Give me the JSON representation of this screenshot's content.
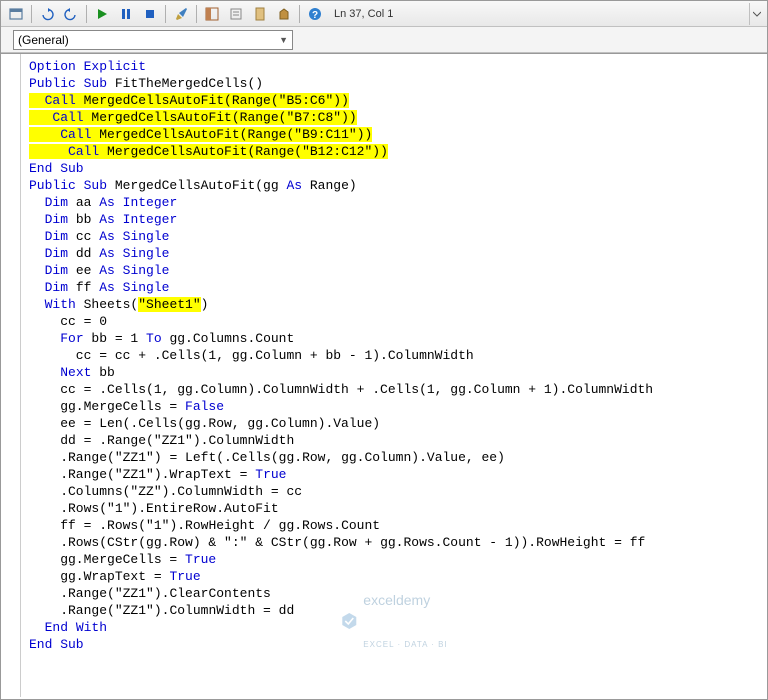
{
  "toolbar": {
    "status": "Ln 37, Col 1"
  },
  "dropdown": {
    "selected": "(General)"
  },
  "code": {
    "l1_opt": "Option Explicit",
    "l2_a": "Public Sub",
    "l2_b": " FitTheMergedCells()",
    "l3_a": "  ",
    "l3_call": "Call",
    "l3_b": " MergedCellsAutoFit(Range(",
    "l3_str": "\"B5:C6\"",
    "l3_c": "))",
    "l4_a": "   ",
    "l4_call": "Call",
    "l4_b": " MergedCellsAutoFit(Range(",
    "l4_str": "\"B7:C8\"",
    "l4_c": "))",
    "l5_a": "    ",
    "l5_call": "Call",
    "l5_b": " MergedCellsAutoFit(Range(",
    "l5_str": "\"B9:C11\"",
    "l5_c": "))",
    "l6_a": "     ",
    "l6_call": "Call",
    "l6_b": " MergedCellsAutoFit(Range(",
    "l6_str": "\"B12:C12\"",
    "l6_c": "))",
    "l7": "End Sub",
    "l8_a": "Public Sub",
    "l8_b": " MergedCellsAutoFit(gg ",
    "l8_as": "As",
    "l8_c": " Range)",
    "l9_a": "  ",
    "l9_dim": "Dim",
    "l9_b": " aa ",
    "l9_as": "As Integer",
    "l10_a": "  ",
    "l10_dim": "Dim",
    "l10_b": " bb ",
    "l10_as": "As Integer",
    "l11_a": "  ",
    "l11_dim": "Dim",
    "l11_b": " cc ",
    "l11_as": "As Single",
    "l12_a": "  ",
    "l12_dim": "Dim",
    "l12_b": " dd ",
    "l12_as": "As Single",
    "l13_a": "  ",
    "l13_dim": "Dim",
    "l13_b": " ee ",
    "l13_as": "As Single",
    "l14_a": "  ",
    "l14_dim": "Dim",
    "l14_b": " ff ",
    "l14_as": "As Single",
    "l15_a": "  ",
    "l15_with": "With",
    "l15_b": " Sheets(",
    "l15_str": "\"Sheet1\"",
    "l15_c": ")",
    "l16": "    cc = 0",
    "l17_a": "    ",
    "l17_for": "For",
    "l17_b": " bb = 1 ",
    "l17_to": "To",
    "l17_c": " gg.Columns.Count",
    "l18": "      cc = cc + .Cells(1, gg.Column + bb - 1).ColumnWidth",
    "l19_a": "    ",
    "l19_next": "Next",
    "l19_b": " bb",
    "l20": "    cc = .Cells(1, gg.Column).ColumnWidth + .Cells(1, gg.Column + 1).ColumnWidth",
    "l21_a": "    gg.MergeCells = ",
    "l21_false": "False",
    "l22": "    ee = Len(.Cells(gg.Row, gg.Column).Value)",
    "l23_a": "    dd = .Range(",
    "l23_str": "\"ZZ1\"",
    "l23_b": ").ColumnWidth",
    "l24_a": "    .Range(",
    "l24_str": "\"ZZ1\"",
    "l24_b": ") = Left(.Cells(gg.Row, gg.Column).Value, ee)",
    "l25_a": "    .Range(",
    "l25_str": "\"ZZ1\"",
    "l25_b": ").WrapText = ",
    "l25_true": "True",
    "l26_a": "    .Columns(",
    "l26_str": "\"ZZ\"",
    "l26_b": ").ColumnWidth = cc",
    "l27_a": "    .Rows(",
    "l27_str": "\"1\"",
    "l27_b": ").EntireRow.AutoFit",
    "l28_a": "    ff = .Rows(",
    "l28_str": "\"1\"",
    "l28_b": ").RowHeight / gg.Rows.Count",
    "l29_a": "    .Rows(CStr(gg.Row) & ",
    "l29_str": "\":\"",
    "l29_b": " & CStr(gg.Row + gg.Rows.Count - 1)).RowHeight = ff",
    "l30_a": "    gg.MergeCells = ",
    "l30_true": "True",
    "l31_a": "    gg.WrapText = ",
    "l31_true": "True",
    "l32_a": "    .Range(",
    "l32_str": "\"ZZ1\"",
    "l32_b": ").ClearContents",
    "l33_a": "    .Range(",
    "l33_str": "\"ZZ1\"",
    "l33_b": ").ColumnWidth = dd",
    "l34_a": "  ",
    "l34_end": "End With",
    "l35": "End Sub"
  },
  "watermark": {
    "main": "exceldemy",
    "sub": "EXCEL · DATA · BI"
  }
}
